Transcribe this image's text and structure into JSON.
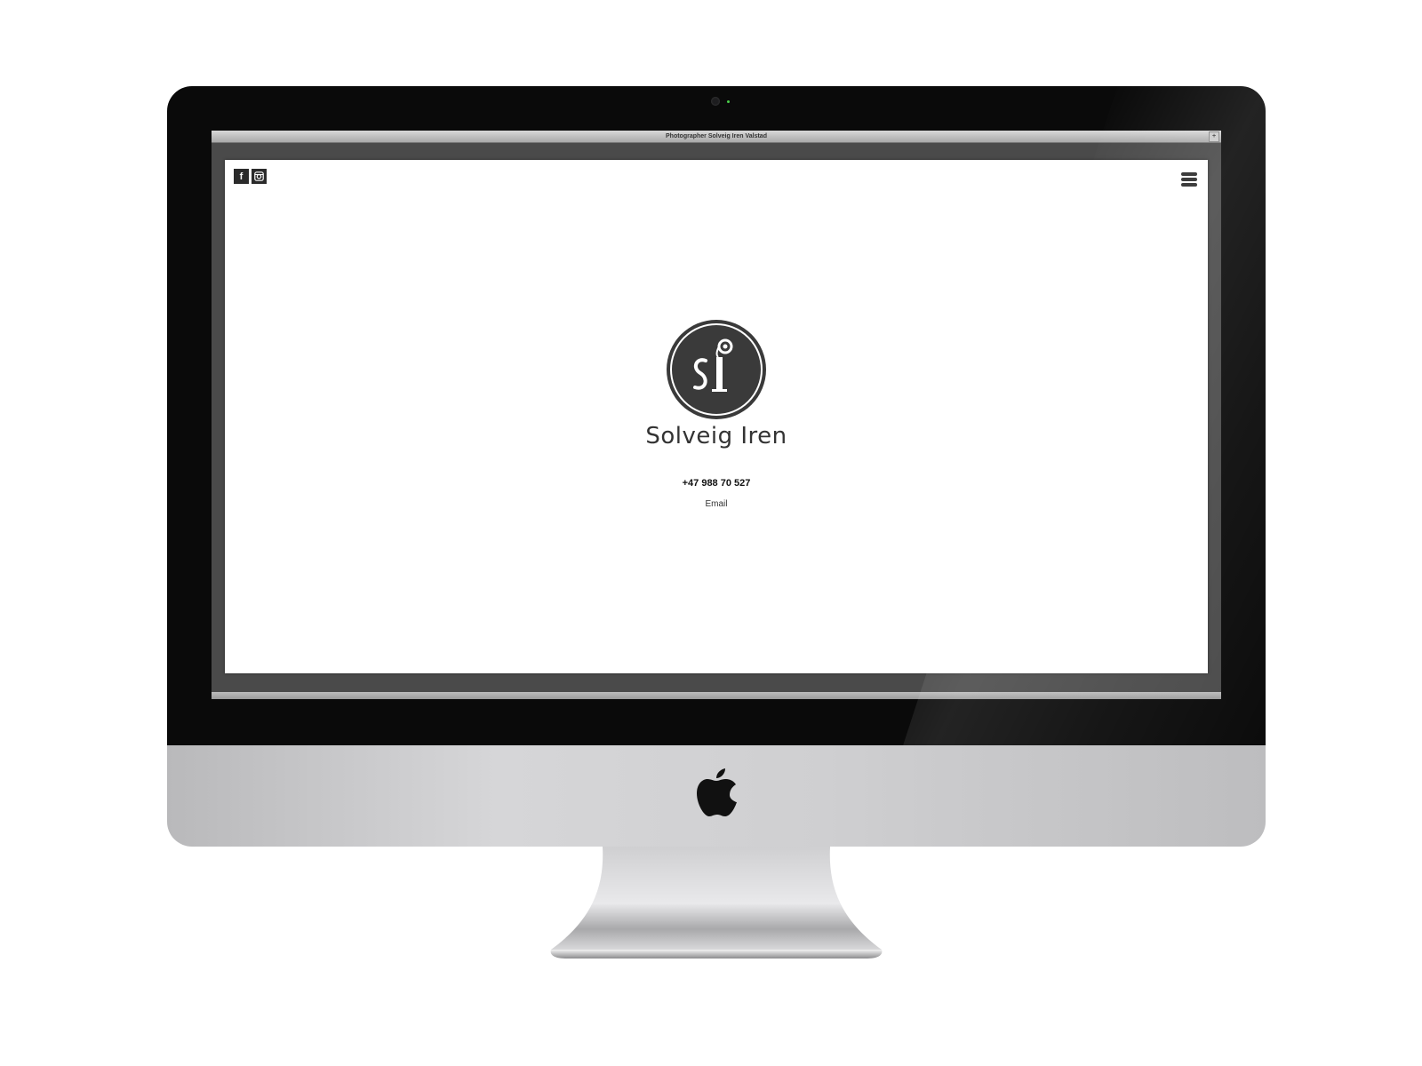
{
  "window": {
    "title": "Photographer Solveig Iren Valstad"
  },
  "social": {
    "facebook_label": "f",
    "instagram_icon": "instagram-icon"
  },
  "menu": {
    "icon": "hamburger-menu-icon"
  },
  "brand": {
    "logo_icon": "si-monogram-logo",
    "name": "Solveig Iren"
  },
  "contact": {
    "phone": "+47 988 70 527",
    "email_label": "Email"
  },
  "colors": {
    "logo_fill": "#3a3a3a",
    "social_bg": "#2b2b2b",
    "page_bg": "#ffffff"
  }
}
